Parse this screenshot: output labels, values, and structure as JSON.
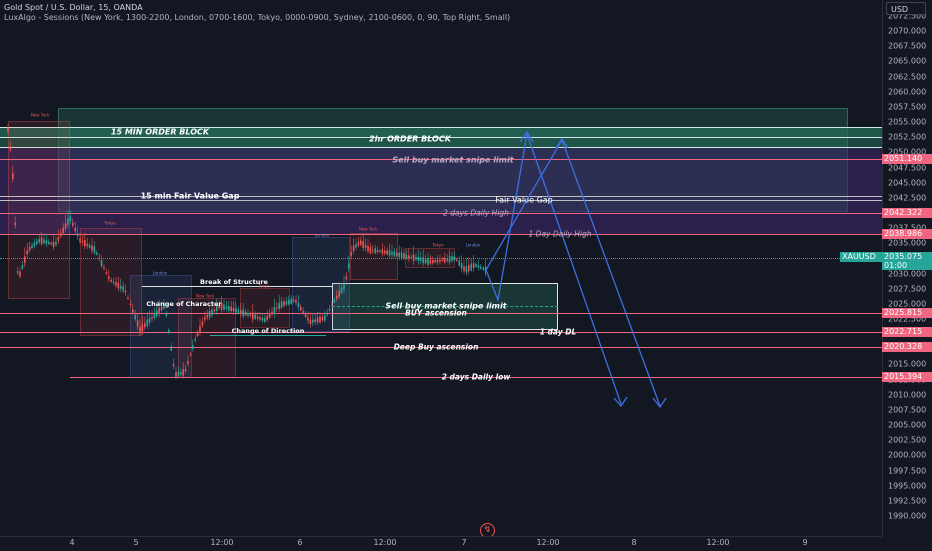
{
  "header": {
    "title": "Gold Spot / U.S. Dollar, 15, OANDA",
    "indicator": "LuxAlgo - Sessions (New York, 1300-2200, London, 0700-1600, Tokyo, 0000-0900, Sydney, 2100-0600, 0, 90, Top Right, Small)"
  },
  "currency": "USD",
  "y_ticks": [
    "2072.500",
    "2070.000",
    "2067.500",
    "2065.000",
    "2062.500",
    "2060.000",
    "2057.500",
    "2055.000",
    "2052.500",
    "2050.000",
    "2047.500",
    "2045.000",
    "2042.500",
    "2040.000",
    "2037.500",
    "2035.000",
    "2032.500",
    "2030.000",
    "2027.500",
    "2025.000",
    "2022.500",
    "2020.000",
    "2017.500",
    "2015.000",
    "2012.500",
    "2010.000",
    "2007.500",
    "2005.000",
    "2002.500",
    "2000.000",
    "1997.500",
    "1995.000",
    "1992.500",
    "1990.000"
  ],
  "x_ticks": [
    "4",
    "5",
    "12:00",
    "6",
    "12:00",
    "7",
    "12:00",
    "8",
    "12:00",
    "9"
  ],
  "price_tags": {
    "t2051": "2051.140",
    "t2042": "2042.322",
    "t2038": "2038.986",
    "symbol": "XAUUSD",
    "last_price": "2035.075",
    "countdown": "01:00",
    "t2025": "2025.815",
    "t2022": "2022.715",
    "t2020": "2020.328",
    "t2015": "2015.394"
  },
  "annotations": {
    "ob15": "15 MIN ORDER BLOCK",
    "ob2h": "2hr ORDER BLOCK",
    "sell_top": "Sell buy market snipe limit",
    "fvg15": "15 min Fair Value Gap",
    "fvg": "Fair Value Gap",
    "daily_high2": "2 days Daily High",
    "daily_high1": "1 Day Daily High",
    "bos": "Break of Structure",
    "choch": "Change of Character",
    "cod": "Change of Direction",
    "sell_low": "Sell buy market snipe limit",
    "buy_asc": "BUY ascension",
    "dl1": "1 day DL",
    "deep_buy": "Deep Buy ascension",
    "daily_low2": "2 days Daily low"
  },
  "sessions": {
    "new_york": "New York",
    "tokyo": "Tokyo",
    "london": "London"
  },
  "colors": {
    "background": "#131722",
    "bull": "#26a69a",
    "bear": "#ef5350",
    "projection": "#3d6fe0",
    "level_red": "#f06680",
    "ob_zone": "#1f4f43",
    "fvg_zone": "#3b2a63"
  },
  "icons": {
    "watermark": "lightning-icon"
  }
}
